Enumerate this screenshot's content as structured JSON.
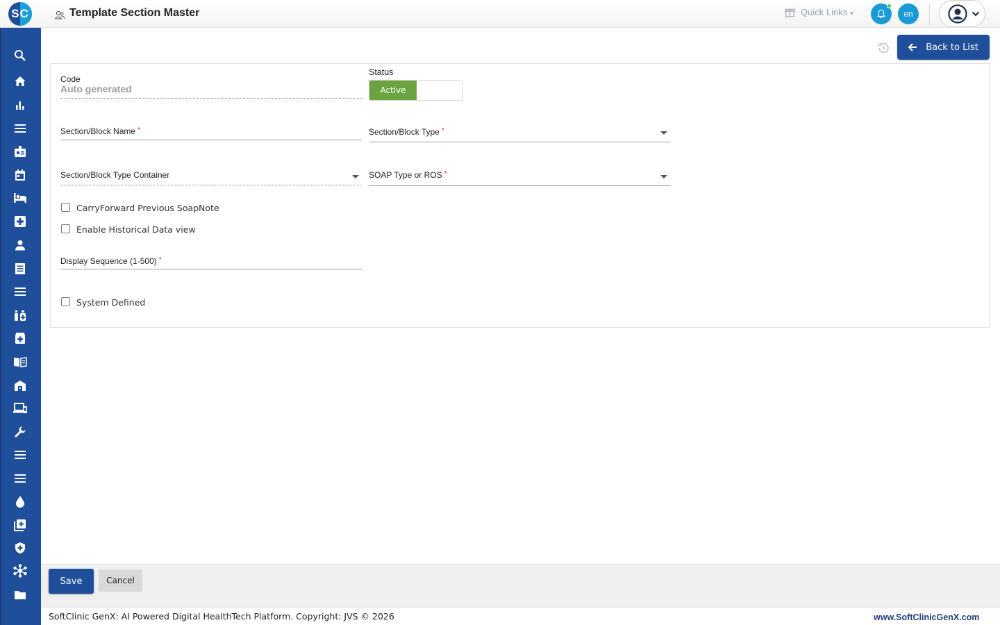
{
  "header": {
    "logo_text": "SC",
    "page_title": "Template Section Master",
    "quick_links": "Quick Links",
    "lang": "en"
  },
  "toolbar": {
    "back_label": "Back to List"
  },
  "form": {
    "code_label": "Code",
    "code_value": "Auto generated",
    "status_label": "Status",
    "status_value": "Active",
    "section_name_label": "Section/Block Name",
    "section_type_label": "Section/Block Type",
    "section_container_label": "Section/Block Type Container",
    "soap_type_label": "SOAP Type or ROS",
    "required_mark": "*",
    "carry_forward_label": "CarryForward Previous SoapNote",
    "historical_label": "Enable Historical Data view",
    "display_seq_label": "Display Sequence (1-500)",
    "system_defined_label": "System Defined"
  },
  "actions": {
    "save": "Save",
    "cancel": "Cancel"
  },
  "footer": {
    "copyright": "SoftClinic GenX: AI Powered Digital HealthTech Platform. Copyright: JVS © 2026",
    "site": "www.SoftClinicGenX.com"
  },
  "sidebar_icons": [
    "search-icon",
    "home-icon",
    "bar-chart-icon",
    "menu-icon",
    "badge-icon",
    "calendar-icon",
    "bed-icon",
    "medical-plus-icon",
    "person-icon",
    "receipt-icon",
    "list-icon",
    "pharmacy-icon",
    "medicine-box-icon",
    "book-icon",
    "store-icon",
    "devices-icon",
    "wrench-icon",
    "menu-icon",
    "menu-icon",
    "drop-icon",
    "add-box-icon",
    "shield-icon",
    "hub-icon",
    "folder-icon"
  ],
  "colors": {
    "primary": "#1f4e9b",
    "accent": "#1a9ad6",
    "active_green": "#6aa33f",
    "required_red": "#e02020"
  }
}
